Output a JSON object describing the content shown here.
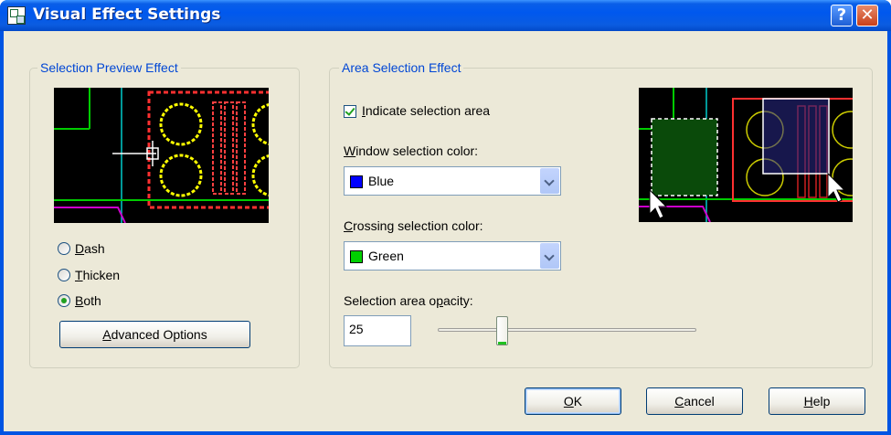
{
  "window": {
    "title": "Visual Effect Settings",
    "help_glyph": "?",
    "close_glyph": "✕"
  },
  "selection_preview": {
    "group_label": "Selection Preview Effect",
    "options": [
      {
        "label_underlined": "D",
        "label_rest": "ash",
        "selected": false
      },
      {
        "label_underlined": "T",
        "label_rest": "hicken",
        "selected": false
      },
      {
        "label_underlined": "B",
        "label_rest": "oth",
        "selected": true
      }
    ],
    "advanced_button": {
      "label_underlined": "A",
      "label_rest": "dvanced Options"
    }
  },
  "area_selection": {
    "group_label": "Area Selection Effect",
    "indicate": {
      "label_underlined": "I",
      "label_rest": "ndicate selection area",
      "checked": true
    },
    "window_color": {
      "label_underlined": "W",
      "label_rest": "indow selection color:",
      "value": "Blue",
      "swatch": "#0000ff"
    },
    "crossing_color": {
      "label_underlined": "C",
      "label_rest": "rossing selection color:",
      "value": "Green",
      "swatch": "#00d000"
    },
    "opacity": {
      "label_pre": "Selection area o",
      "label_underlined": "p",
      "label_rest": "acity:",
      "value": "25"
    }
  },
  "buttons": {
    "ok": {
      "label_underlined": "O",
      "label_rest": "K"
    },
    "cancel": {
      "label_underlined": "C",
      "label_rest": "ancel"
    },
    "help": {
      "label_underlined": "H",
      "label_rest": "elp"
    }
  }
}
